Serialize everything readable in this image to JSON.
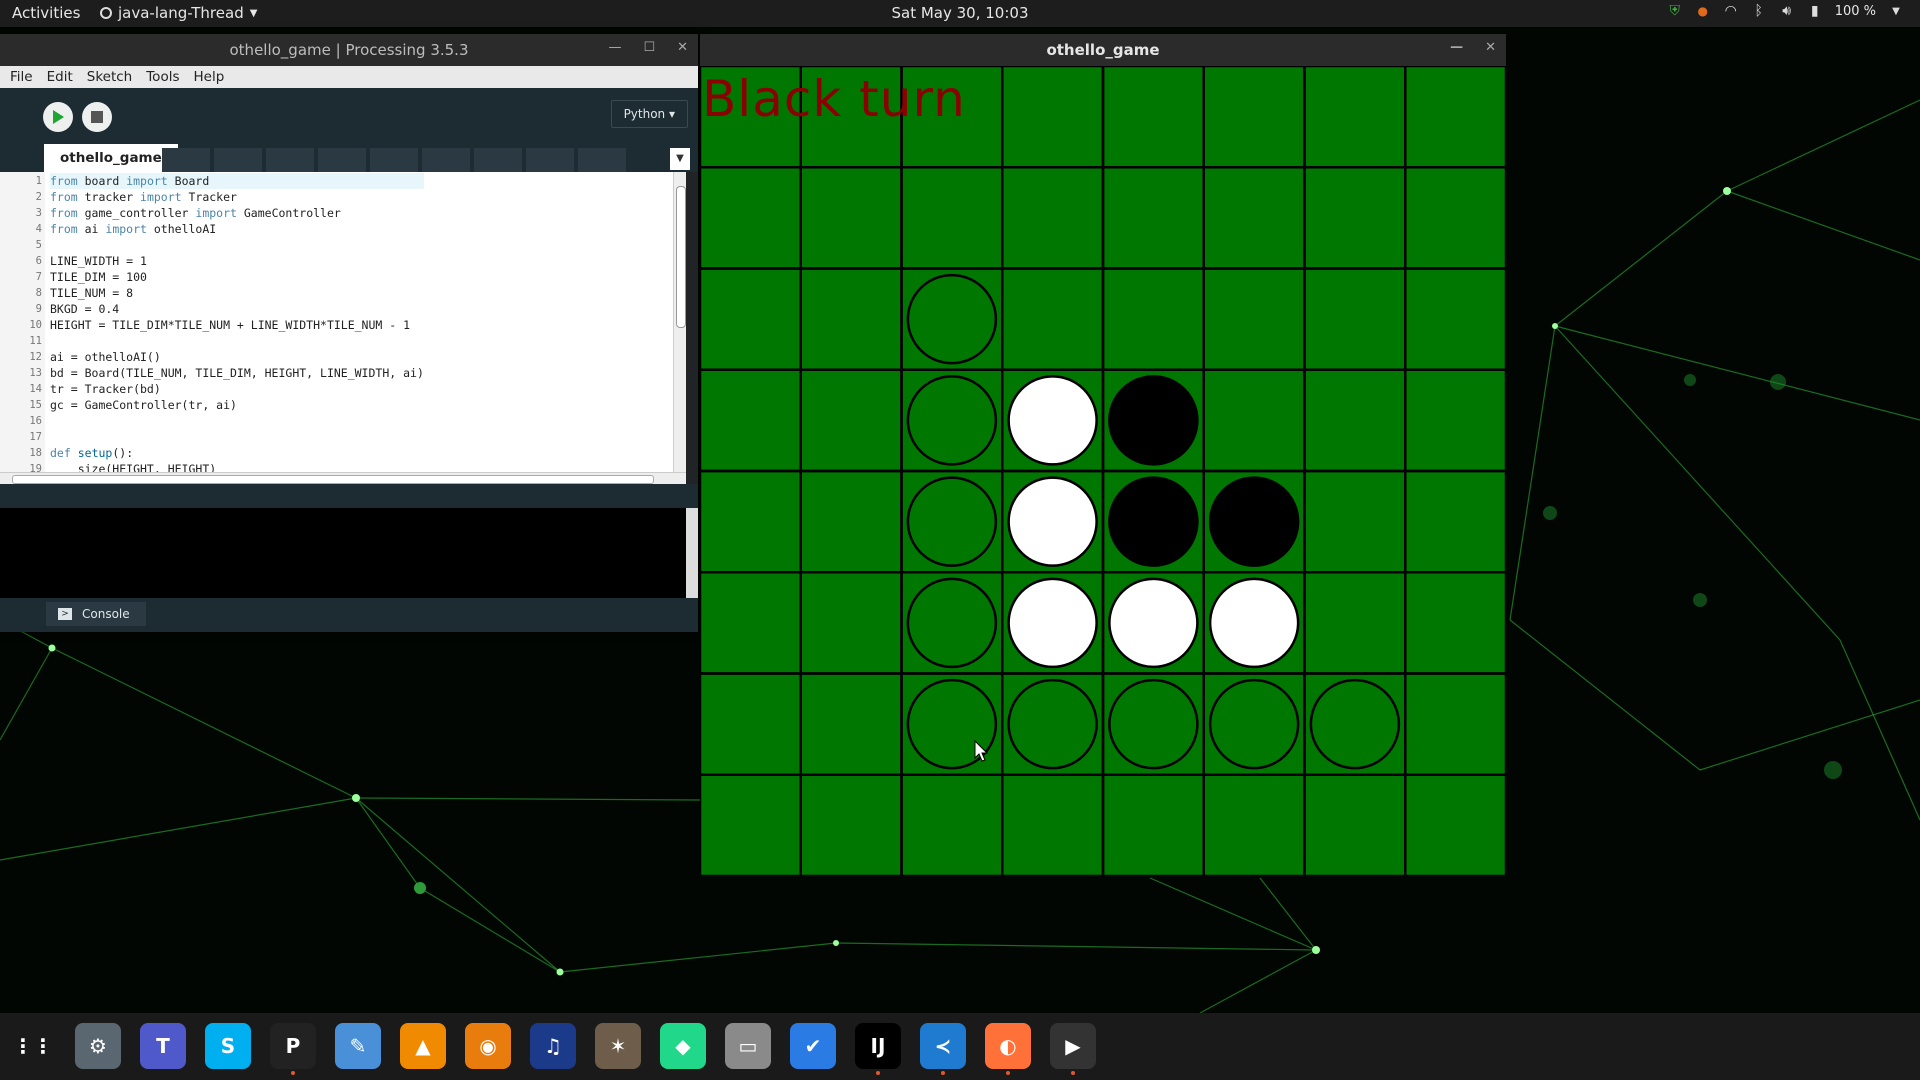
{
  "topbar": {
    "activities": "Activities",
    "app_name": "java-lang-Thread",
    "clock": "Sat May 30, 10:03",
    "battery": "100 %",
    "icons": [
      "shield-icon",
      "notification-dot-icon",
      "wifi-icon",
      "bluetooth-icon",
      "volume-icon",
      "battery-icon",
      "system-menu-icon"
    ]
  },
  "ide": {
    "title": "othello_game | Processing 3.5.3",
    "menu": [
      "File",
      "Edit",
      "Sketch",
      "Tools",
      "Help"
    ],
    "mode": "Python ▾",
    "tab_name": "othello_game",
    "code_lines": [
      {
        "n": "1",
        "parts": [
          [
            "kw",
            "from"
          ],
          [
            "t",
            " board "
          ],
          [
            "kw",
            "import"
          ],
          [
            "t",
            " Board"
          ]
        ]
      },
      {
        "n": "2",
        "parts": [
          [
            "kw",
            "from"
          ],
          [
            "t",
            " tracker "
          ],
          [
            "kw",
            "import"
          ],
          [
            "t",
            " Tracker"
          ]
        ]
      },
      {
        "n": "3",
        "parts": [
          [
            "kw",
            "from"
          ],
          [
            "t",
            " game_controller "
          ],
          [
            "kw",
            "import"
          ],
          [
            "t",
            " GameController"
          ]
        ]
      },
      {
        "n": "4",
        "parts": [
          [
            "kw",
            "from"
          ],
          [
            "t",
            " ai "
          ],
          [
            "kw",
            "import"
          ],
          [
            "t",
            " othelloAI"
          ]
        ]
      },
      {
        "n": "5",
        "parts": [
          [
            "t",
            ""
          ]
        ]
      },
      {
        "n": "6",
        "parts": [
          [
            "t",
            "LINE_WIDTH = 1"
          ]
        ]
      },
      {
        "n": "7",
        "parts": [
          [
            "t",
            "TILE_DIM = 100"
          ]
        ]
      },
      {
        "n": "8",
        "parts": [
          [
            "t",
            "TILE_NUM = 8"
          ]
        ]
      },
      {
        "n": "9",
        "parts": [
          [
            "t",
            "BKGD = 0.4"
          ]
        ]
      },
      {
        "n": "10",
        "parts": [
          [
            "t",
            "HEIGHT = TILE_DIM*TILE_NUM + LINE_WIDTH*TILE_NUM - 1"
          ]
        ]
      },
      {
        "n": "11",
        "parts": [
          [
            "t",
            ""
          ]
        ]
      },
      {
        "n": "12",
        "parts": [
          [
            "t",
            "ai = othelloAI()"
          ]
        ]
      },
      {
        "n": "13",
        "parts": [
          [
            "t",
            "bd = Board(TILE_NUM, TILE_DIM, HEIGHT, LINE_WIDTH, ai)"
          ]
        ]
      },
      {
        "n": "14",
        "parts": [
          [
            "t",
            "tr = Tracker(bd)"
          ]
        ]
      },
      {
        "n": "15",
        "parts": [
          [
            "t",
            "gc = GameController(tr, ai)"
          ]
        ]
      },
      {
        "n": "16",
        "parts": [
          [
            "t",
            ""
          ]
        ]
      },
      {
        "n": "17",
        "parts": [
          [
            "t",
            ""
          ]
        ]
      },
      {
        "n": "18",
        "parts": [
          [
            "kw",
            "def"
          ],
          [
            "t",
            " "
          ],
          [
            "fn",
            "setup"
          ],
          [
            "t",
            "():"
          ]
        ]
      },
      {
        "n": "19",
        "parts": [
          [
            "t",
            "    size(HEIGHT, HEIGHT)"
          ]
        ]
      }
    ],
    "console_label": "Console"
  },
  "game": {
    "title": "othello_game",
    "turn_text": "Black turn",
    "colors": {
      "board": "#007700",
      "line": "#000000",
      "turn_text": "#8b0000"
    },
    "grid_size": 8,
    "pieces": [
      {
        "row": 2,
        "col": 2,
        "state": "hint"
      },
      {
        "row": 3,
        "col": 2,
        "state": "hint"
      },
      {
        "row": 3,
        "col": 3,
        "state": "white"
      },
      {
        "row": 3,
        "col": 4,
        "state": "black"
      },
      {
        "row": 4,
        "col": 2,
        "state": "hint"
      },
      {
        "row": 4,
        "col": 3,
        "state": "white"
      },
      {
        "row": 4,
        "col": 4,
        "state": "black"
      },
      {
        "row": 4,
        "col": 5,
        "state": "black"
      },
      {
        "row": 5,
        "col": 2,
        "state": "hint"
      },
      {
        "row": 5,
        "col": 3,
        "state": "white"
      },
      {
        "row": 5,
        "col": 4,
        "state": "white"
      },
      {
        "row": 5,
        "col": 5,
        "state": "white"
      },
      {
        "row": 6,
        "col": 2,
        "state": "hint"
      },
      {
        "row": 6,
        "col": 3,
        "state": "hint"
      },
      {
        "row": 6,
        "col": 4,
        "state": "hint"
      },
      {
        "row": 6,
        "col": 5,
        "state": "hint"
      },
      {
        "row": 6,
        "col": 6,
        "state": "hint"
      }
    ]
  },
  "dock": {
    "items": [
      {
        "name": "app-grid-icon",
        "glyph": "⋮⋮",
        "bg": "#1a1a1a",
        "active": false
      },
      {
        "name": "settings-icon",
        "glyph": "⚙",
        "bg": "#5b6770",
        "active": false
      },
      {
        "name": "teams-icon",
        "glyph": "T",
        "bg": "#5059c9",
        "active": false
      },
      {
        "name": "skype-icon",
        "glyph": "S",
        "bg": "#00aff0",
        "active": false
      },
      {
        "name": "processing-icon",
        "glyph": "P",
        "bg": "#222222",
        "active": true
      },
      {
        "name": "text-editor-icon",
        "glyph": "✎",
        "bg": "#4a90d9",
        "active": false
      },
      {
        "name": "vlc-icon",
        "glyph": "▲",
        "bg": "#f08a00",
        "active": false
      },
      {
        "name": "blender-icon",
        "glyph": "◉",
        "bg": "#e87d0d",
        "active": false
      },
      {
        "name": "audacity-icon",
        "glyph": "♫",
        "bg": "#1c3a8a",
        "active": false
      },
      {
        "name": "gimp-icon",
        "glyph": "✶",
        "bg": "#6d5d4a",
        "active": false
      },
      {
        "name": "pycharm-icon",
        "glyph": "◆",
        "bg": "#21d789",
        "active": false
      },
      {
        "name": "archive-icon",
        "glyph": "▭",
        "bg": "#8a8a8a",
        "active": false
      },
      {
        "name": "tasks-icon",
        "glyph": "✔",
        "bg": "#2a7be4",
        "active": false
      },
      {
        "name": "intellij-icon",
        "glyph": "IJ",
        "bg": "#000000",
        "active": true
      },
      {
        "name": "vscode-icon",
        "glyph": "≺",
        "bg": "#1e7bd0",
        "active": true
      },
      {
        "name": "firefox-icon",
        "glyph": "◐",
        "bg": "#ff7139",
        "active": true
      },
      {
        "name": "java-thread-app-icon",
        "glyph": "▶",
        "bg": "#333333",
        "active": true
      }
    ]
  }
}
